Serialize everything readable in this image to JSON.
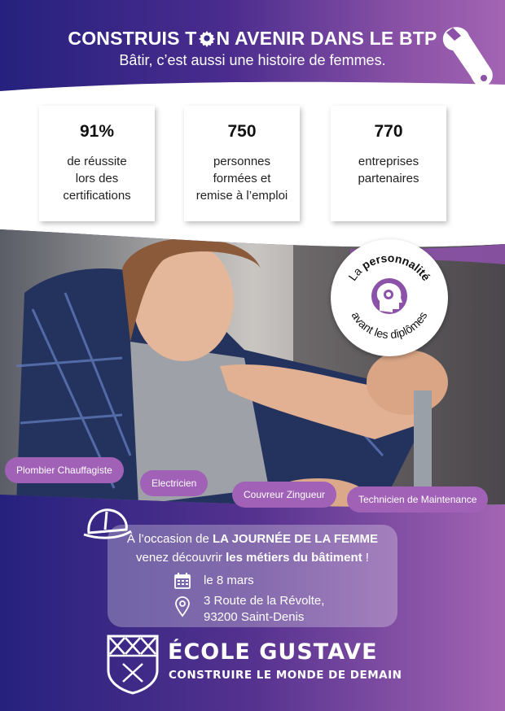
{
  "header": {
    "title_before": "CONSTRUIS T",
    "title_after": "N AVENIR DANS LE BTP",
    "subtitle": "Bâtir, c’est aussi une histoire de femmes."
  },
  "stats": [
    {
      "value": "91%",
      "label_lines": [
        "de réussite",
        "lors des",
        "certifications"
      ]
    },
    {
      "value": "750",
      "label_lines": [
        "personnes",
        "formées et",
        "remise à l’emploi"
      ]
    },
    {
      "value": "770",
      "label_lines": [
        "entreprises",
        "partenaires"
      ]
    }
  ],
  "badge": {
    "top_prefix": "La ",
    "top_bold": "personnalité",
    "bottom": "avant les diplômes"
  },
  "trades": [
    "Plombier Chauffagiste",
    "Electricien",
    "Couvreur Zingueur",
    "Technicien de Maintenance"
  ],
  "event": {
    "line1_prefix": "À l’occasion de ",
    "line1_bold": "LA JOURNÉE DE LA FEMME",
    "line2_prefix": "venez découvrir ",
    "line2_bold": "les métiers du bâtiment",
    "line2_suffix": " !",
    "date": "le 8 mars",
    "address_line1": "3 Route de la Révolte,",
    "address_line2": "93200 Saint-Denis"
  },
  "school": {
    "name": "ÉCOLE GUSTAVE",
    "tagline": "CONSTRUIRE LE MONDE DE DEMAIN"
  },
  "colors": {
    "accent": "#8c52a8",
    "deep_blue": "#26217e",
    "purple": "#a364b3",
    "pill": "#a061b6"
  },
  "icons": [
    "gear-icon",
    "wrench-icon",
    "head-gear-icon",
    "hard-hat-icon",
    "calendar-icon",
    "location-pin-icon",
    "crest-logo"
  ]
}
